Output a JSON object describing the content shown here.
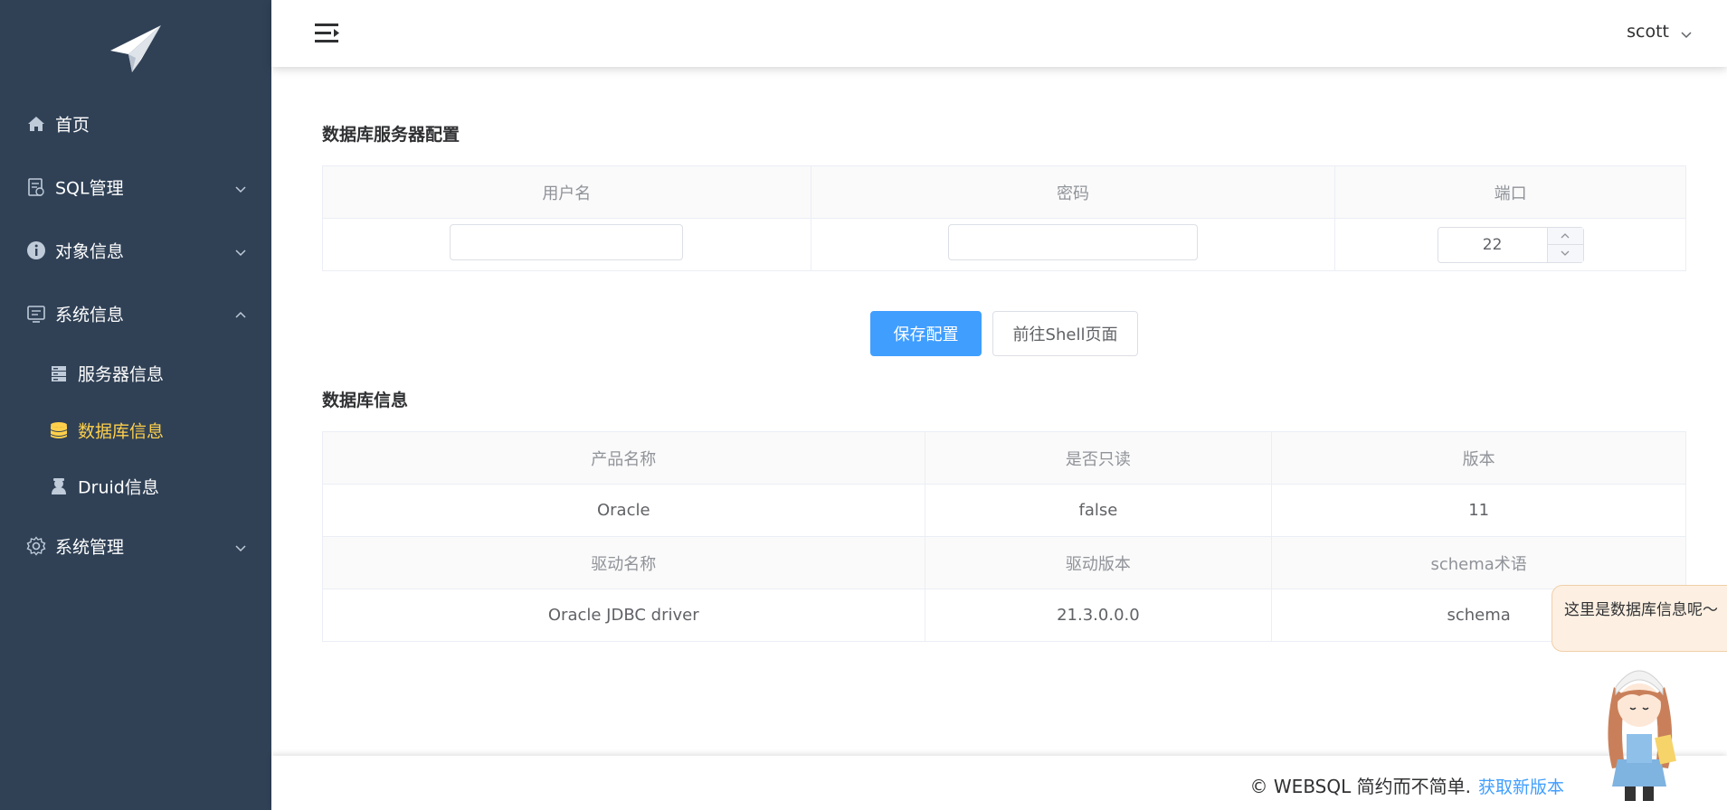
{
  "sidebar": {
    "items": [
      {
        "label": "首页",
        "icon": "home-icon"
      },
      {
        "label": "SQL管理",
        "icon": "sql-file-icon"
      },
      {
        "label": "对象信息",
        "icon": "info-icon"
      },
      {
        "label": "系统信息",
        "icon": "monitor-icon"
      },
      {
        "label": "服务器信息",
        "icon": "server-icon"
      },
      {
        "label": "数据库信息",
        "icon": "database-icon"
      },
      {
        "label": "Druid信息",
        "icon": "druid-icon"
      },
      {
        "label": "系统管理",
        "icon": "gear-icon"
      }
    ],
    "active_color": "#ffd04b",
    "bg_color": "#304156"
  },
  "header": {
    "username": "scott"
  },
  "server_config": {
    "title": "数据库服务器配置",
    "columns": [
      "用户名",
      "密码",
      "端口"
    ],
    "username_value": "",
    "password_value": "",
    "port_value": "22"
  },
  "buttons": {
    "save": "保存配置",
    "shell": "前往Shell页面"
  },
  "db_info": {
    "title": "数据库信息",
    "header_row_1": [
      "产品名称",
      "是否只读",
      "版本"
    ],
    "row_1": [
      "Oracle",
      "false",
      "11"
    ],
    "header_row_2": [
      "驱动名称",
      "驱动版本",
      "schema术语"
    ],
    "row_2": [
      "Oracle JDBC driver",
      "21.3.0.0.0",
      "schema"
    ]
  },
  "footer": {
    "text": "© WEBSQL 简约而不简单.",
    "link": "获取新版本"
  },
  "mascot": {
    "bubble": "这里是数据库信息呢～"
  },
  "colors": {
    "primary": "#409eff",
    "sidebar": "#304156",
    "active": "#ffd04b"
  }
}
